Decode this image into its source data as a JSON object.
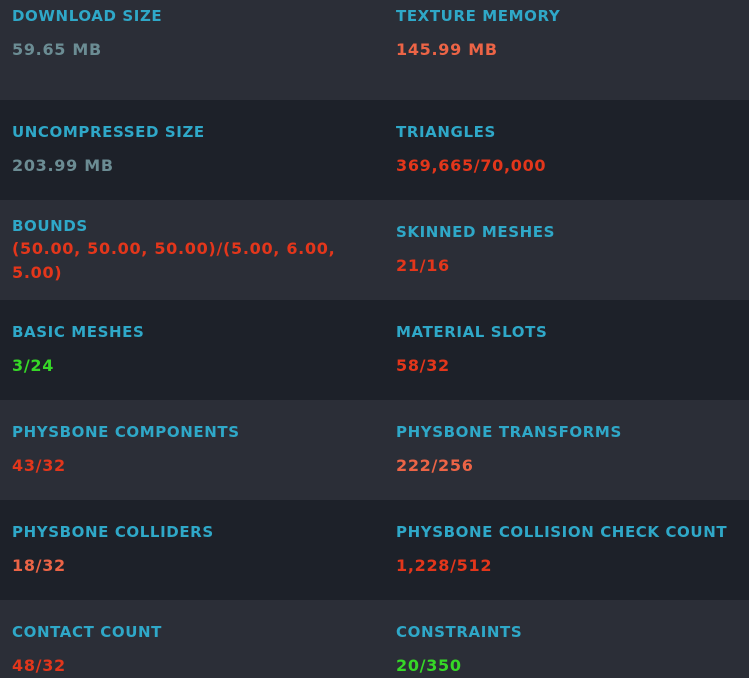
{
  "colors": {
    "label": "#2fa8c8",
    "gray": "#6b8c93",
    "red": "#e3361b",
    "salmon": "#ec6446",
    "green": "#36d727",
    "row_light": "#2b2e37",
    "row_dark": "#1d2129"
  },
  "stats": {
    "download_size": {
      "label": "DOWNLOAD SIZE",
      "value": "59.65 MB"
    },
    "texture_memory": {
      "label": "TEXTURE MEMORY",
      "value": "145.99 MB"
    },
    "uncompressed_size": {
      "label": "UNCOMPRESSED SIZE",
      "value": "203.99 MB"
    },
    "triangles": {
      "label": "TRIANGLES",
      "value": "369,665/70,000"
    },
    "bounds": {
      "label": "BOUNDS",
      "value": "(50.00, 50.00, 50.00)/(5.00, 6.00, 5.00)"
    },
    "skinned_meshes": {
      "label": "SKINNED MESHES",
      "value": "21/16"
    },
    "basic_meshes": {
      "label": "BASIC MESHES",
      "value": "3/24"
    },
    "material_slots": {
      "label": "MATERIAL SLOTS",
      "value": "58/32"
    },
    "physbone_components": {
      "label": "PHYSBONE COMPONENTS",
      "value": "43/32"
    },
    "physbone_transforms": {
      "label": "PHYSBONE TRANSFORMS",
      "value": "222/256"
    },
    "physbone_colliders": {
      "label": "PHYSBONE COLLIDERS",
      "value": "18/32"
    },
    "physbone_collision_check_count": {
      "label": "PHYSBONE COLLISION CHECK COUNT",
      "value": "1,228/512"
    },
    "contact_count": {
      "label": "CONTACT COUNT",
      "value": "48/32"
    },
    "constraints": {
      "label": "CONSTRAINTS",
      "value": "20/350"
    }
  }
}
